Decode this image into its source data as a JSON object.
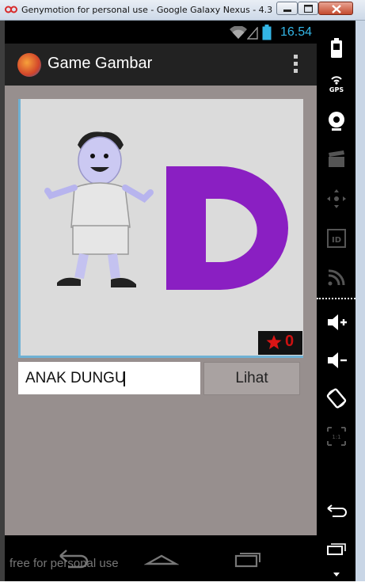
{
  "window": {
    "title": "Genymotion for personal use - Google Galaxy Nexus - 4.3 ..."
  },
  "status_bar": {
    "time": "16.54"
  },
  "action_bar": {
    "app_title": "Game Gambar"
  },
  "game": {
    "letter": "D",
    "score": "0",
    "answer_value": "ANAK DUNGU",
    "button_label": "Lihat"
  },
  "sidebar": {
    "gps_label": "GPS",
    "id_label": "ID",
    "scale_label": "1:1"
  },
  "watermark": "free for personal use",
  "colors": {
    "accent_blue": "#33b5e5",
    "letter_purple": "#8a1fc2",
    "content_bg": "#978f8e",
    "score_red": "#cc1111"
  },
  "icons": [
    "battery-icon",
    "gps-icon",
    "webcam-icon",
    "clapper-icon",
    "dpad-icon",
    "id-icon",
    "cast-icon",
    "volume-up-icon",
    "volume-down-icon",
    "rotate-icon",
    "scale-icon",
    "back-icon",
    "recent-apps-icon",
    "chevron-down-icon"
  ]
}
